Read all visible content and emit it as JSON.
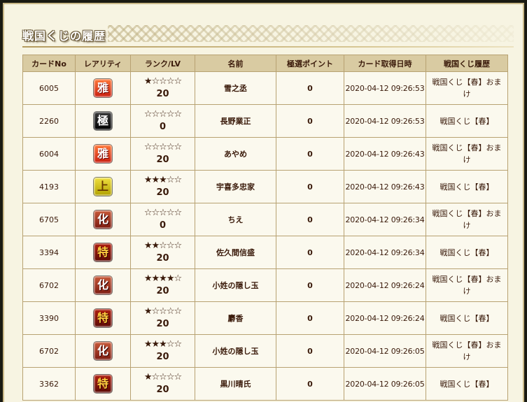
{
  "page": {
    "title": "戦国くじの履歴"
  },
  "table": {
    "headers": {
      "card_no": "カードNo",
      "rarity": "レアリティ",
      "rank_lv": "ランク/LV",
      "name": "名前",
      "points": "極選ポイント",
      "acquired": "カード取得日時",
      "history": "戦国くじ履歴"
    },
    "rows": [
      {
        "card_no": "6005",
        "rarity": "雅",
        "rarity_class": "r-miyabi",
        "stars": "★☆☆☆☆",
        "star_level": 1,
        "lv": "20",
        "name": "雪之丞",
        "points": "0",
        "acquired": "2020-04-12 09:26:53",
        "history": "戦国くじ【春】おまけ"
      },
      {
        "card_no": "2260",
        "rarity": "極",
        "rarity_class": "r-goku",
        "stars": "☆☆☆☆☆",
        "star_level": 0,
        "lv": "0",
        "name": "長野業正",
        "points": "0",
        "acquired": "2020-04-12 09:26:53",
        "history": "戦国くじ【春】"
      },
      {
        "card_no": "6004",
        "rarity": "雅",
        "rarity_class": "r-miyabi",
        "stars": "☆☆☆☆☆",
        "star_level": 0,
        "lv": "20",
        "name": "あやめ",
        "points": "0",
        "acquired": "2020-04-12 09:26:43",
        "history": "戦国くじ【春】おまけ"
      },
      {
        "card_no": "4193",
        "rarity": "上",
        "rarity_class": "r-jou",
        "stars": "★★★☆☆",
        "star_level": 3,
        "lv": "20",
        "name": "宇喜多忠家",
        "points": "0",
        "acquired": "2020-04-12 09:26:43",
        "history": "戦国くじ【春】"
      },
      {
        "card_no": "6705",
        "rarity": "化",
        "rarity_class": "r-ka",
        "stars": "☆☆☆☆☆",
        "star_level": 0,
        "lv": "0",
        "name": "ちえ",
        "points": "0",
        "acquired": "2020-04-12 09:26:34",
        "history": "戦国くじ【春】おまけ"
      },
      {
        "card_no": "3394",
        "rarity": "特",
        "rarity_class": "r-toku",
        "stars": "★★☆☆☆",
        "star_level": 2,
        "lv": "20",
        "name": "佐久間信盛",
        "points": "0",
        "acquired": "2020-04-12 09:26:34",
        "history": "戦国くじ【春】"
      },
      {
        "card_no": "6702",
        "rarity": "化",
        "rarity_class": "r-ka",
        "stars": "★★★★☆",
        "star_level": 4,
        "lv": "20",
        "name": "小姓の隠し玉",
        "points": "0",
        "acquired": "2020-04-12 09:26:24",
        "history": "戦国くじ【春】おまけ"
      },
      {
        "card_no": "3390",
        "rarity": "特",
        "rarity_class": "r-toku",
        "stars": "★☆☆☆☆",
        "star_level": 1,
        "lv": "20",
        "name": "麝香",
        "points": "0",
        "acquired": "2020-04-12 09:26:24",
        "history": "戦国くじ【春】"
      },
      {
        "card_no": "6702",
        "rarity": "化",
        "rarity_class": "r-ka",
        "stars": "★★★☆☆",
        "star_level": 3,
        "lv": "20",
        "name": "小姓の隠し玉",
        "points": "0",
        "acquired": "2020-04-12 09:26:05",
        "history": "戦国くじ【春】おまけ"
      },
      {
        "card_no": "3362",
        "rarity": "特",
        "rarity_class": "r-toku",
        "stars": "★☆☆☆☆",
        "star_level": 1,
        "lv": "20",
        "name": "黒川晴氏",
        "points": "0",
        "acquired": "2020-04-12 09:26:05",
        "history": "戦国くじ【春】"
      }
    ]
  }
}
